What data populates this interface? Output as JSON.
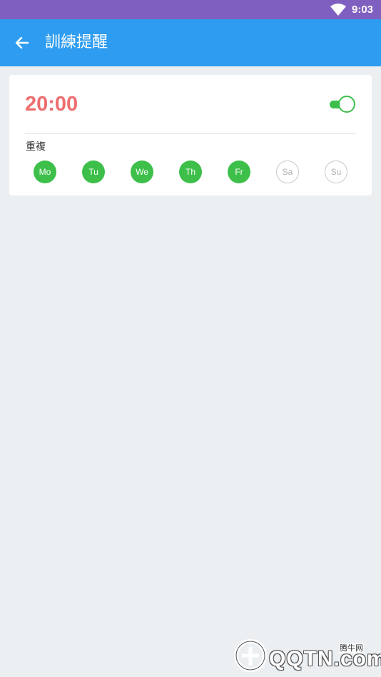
{
  "status_bar": {
    "time": "9:03",
    "background_color": "#7f5fbf",
    "icons": [
      "wifi-icon"
    ]
  },
  "app_bar": {
    "title": "訓練提醒",
    "background_color": "#2e9cf0",
    "back_icon": "arrow-left-icon"
  },
  "reminder": {
    "time": "20:00",
    "time_color": "#ee6d6f",
    "enabled": true,
    "toggle_color": "#3dbf4a",
    "repeat_label": "重複",
    "days": [
      {
        "label": "Mo",
        "selected": true
      },
      {
        "label": "Tu",
        "selected": true
      },
      {
        "label": "We",
        "selected": true
      },
      {
        "label": "Th",
        "selected": true
      },
      {
        "label": "Fr",
        "selected": true
      },
      {
        "label": "Sa",
        "selected": false
      },
      {
        "label": "Su",
        "selected": false
      }
    ]
  },
  "watermark": {
    "text": "QQTN.com",
    "small_text": "腾牛网"
  }
}
